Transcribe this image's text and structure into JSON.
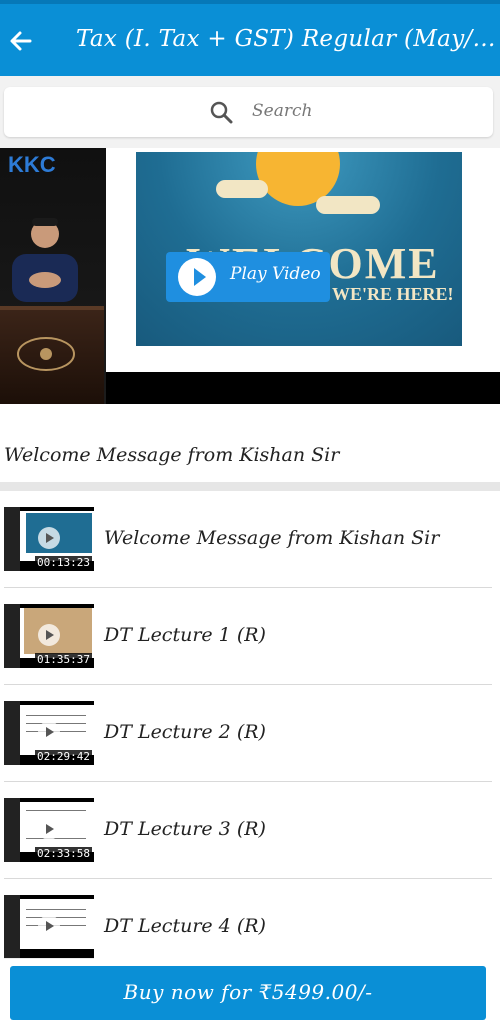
{
  "appbar": {
    "title": "Tax (I. Tax + GST) Regular (May/N...",
    "back_icon": "arrow-left-icon",
    "color": "#0a8fd6"
  },
  "search": {
    "placeholder": "Search",
    "icon": "search-icon"
  },
  "player": {
    "play_label": "Play Video",
    "logo_text": "KKC",
    "slide_title": "WELCOME",
    "slide_subtitle": "WE'RE HERE!"
  },
  "current_video": {
    "title": "Welcome Message from Kishan Sir"
  },
  "lectures": [
    {
      "title": "Welcome Message from Kishan Sir",
      "duration": "00:13:23"
    },
    {
      "title": "DT Lecture 1 (R)",
      "duration": "01:35:37"
    },
    {
      "title": "DT Lecture 2 (R)",
      "duration": "02:29:42"
    },
    {
      "title": "DT Lecture 3 (R)",
      "duration": "02:33:58"
    },
    {
      "title": "DT Lecture 4 (R)",
      "duration": ""
    }
  ],
  "buy": {
    "label": "Buy now for ₹5499.00/-"
  }
}
